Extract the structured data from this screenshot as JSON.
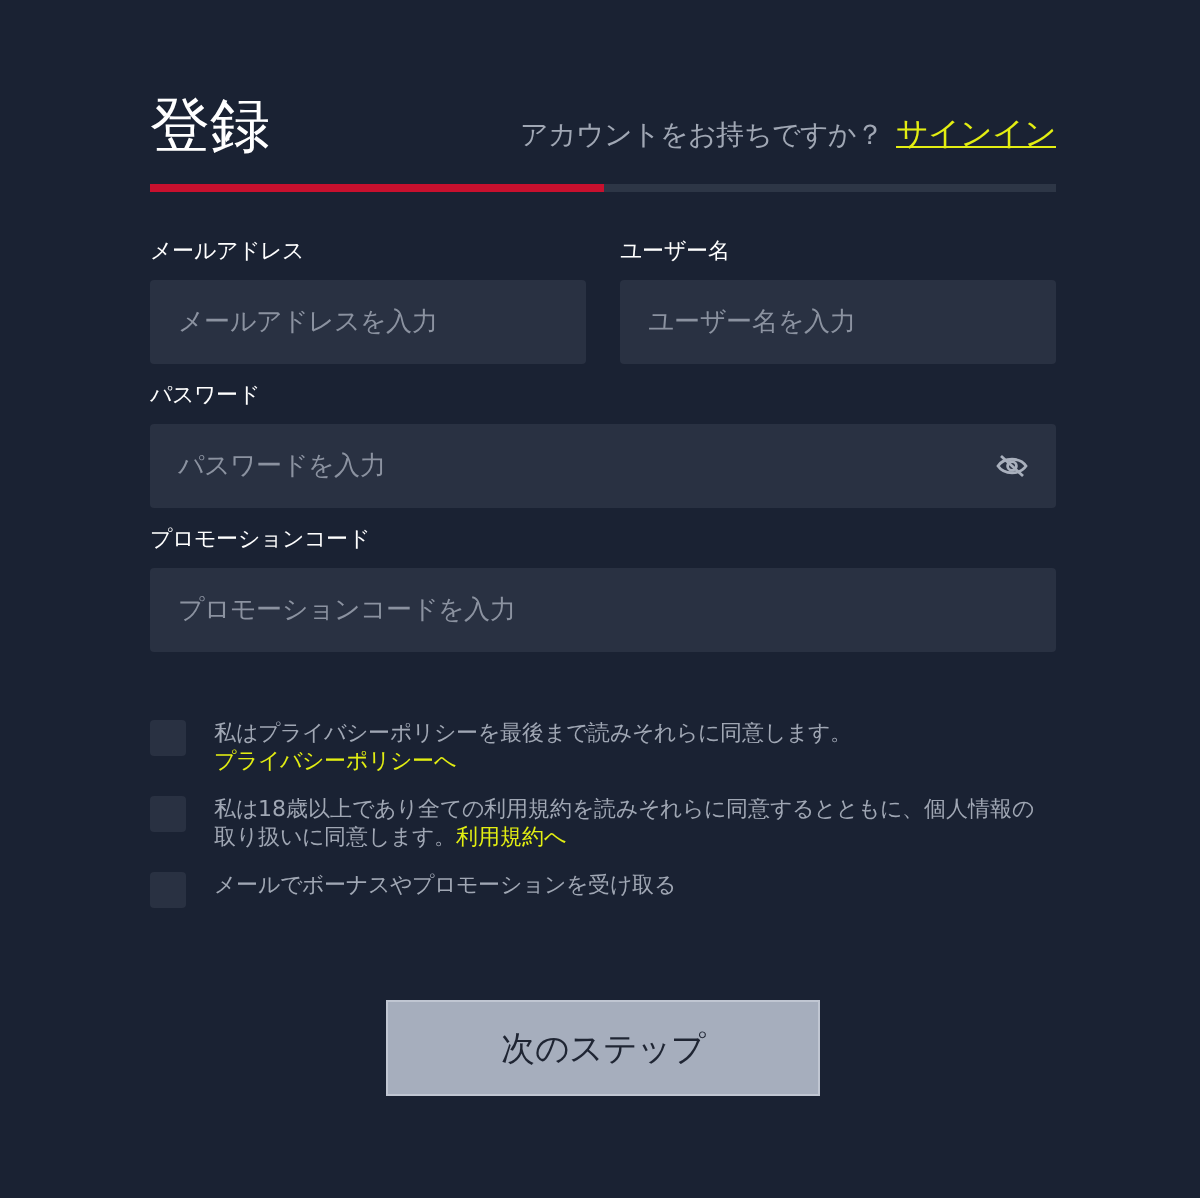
{
  "header": {
    "title": "登録",
    "prompt": "アカウントをお持ちですか？",
    "signin_link": "サインイン"
  },
  "progress": {
    "level": 0.5
  },
  "fields": [
    {
      "label": "メールアドレス",
      "placeholder": "メールアドレスを入力",
      "kind": "half"
    },
    {
      "label": "ユーザー名",
      "placeholder": "ユーザー名を入力",
      "kind": "half"
    },
    {
      "label": "パスワード",
      "placeholder": "パスワードを入力",
      "kind": "password"
    },
    {
      "label": "プロモーションコード",
      "placeholder": "プロモーションコードを入力",
      "kind": "full"
    }
  ],
  "consents": [
    {
      "text": "私はプライバシーポリシーを最後まで読みそれらに同意します。",
      "link": "プライバシーポリシーへ",
      "checked": false
    },
    {
      "text": "私は18歳以上であり全ての利用規約を読みそれらに同意するとともに、個人情報の取り扱いに同意します。",
      "link": "利用規約へ",
      "checked": false
    },
    {
      "text": "メールでボーナスやプロモーションを受け取る",
      "checked": false
    }
  ],
  "next_button": "次のステップ"
}
